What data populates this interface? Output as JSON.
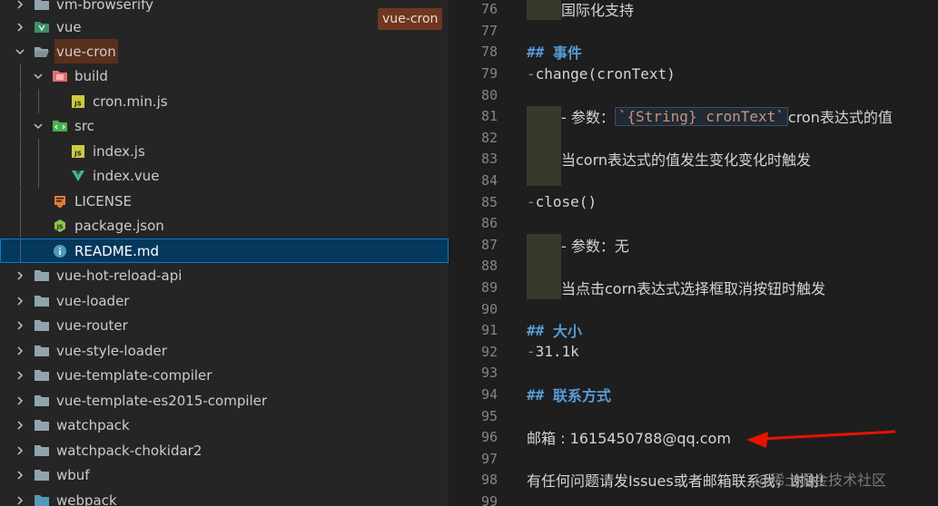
{
  "explorer": {
    "hover_tag": "vue-cron",
    "rows": [
      {
        "label": "vm-browserify",
        "type": "folder",
        "chevron": "right"
      },
      {
        "label": "vue",
        "type": "vue-folder",
        "chevron": "right"
      },
      {
        "label": "vue-cron",
        "type": "folder-open",
        "chevron": "down"
      },
      {
        "label": "build",
        "type": "build-folder",
        "chevron": "down"
      },
      {
        "label": "cron.min.js",
        "type": "js-file"
      },
      {
        "label": "src",
        "type": "src-folder",
        "chevron": "down"
      },
      {
        "label": "index.js",
        "type": "js-file"
      },
      {
        "label": "index.vue",
        "type": "vue-file"
      },
      {
        "label": "LICENSE",
        "type": "license-file"
      },
      {
        "label": "package.json",
        "type": "json-file"
      },
      {
        "label": "README.md",
        "type": "info-file"
      },
      {
        "label": "vue-hot-reload-api",
        "type": "folder",
        "chevron": "right"
      },
      {
        "label": "vue-loader",
        "type": "folder",
        "chevron": "right"
      },
      {
        "label": "vue-router",
        "type": "folder",
        "chevron": "right"
      },
      {
        "label": "vue-style-loader",
        "type": "folder",
        "chevron": "right"
      },
      {
        "label": "vue-template-compiler",
        "type": "folder",
        "chevron": "right"
      },
      {
        "label": "vue-template-es2015-compiler",
        "type": "folder",
        "chevron": "right"
      },
      {
        "label": "watchpack",
        "type": "folder",
        "chevron": "right"
      },
      {
        "label": "watchpack-chokidar2",
        "type": "folder",
        "chevron": "right"
      },
      {
        "label": "wbuf",
        "type": "folder",
        "chevron": "right"
      },
      {
        "label": "webpack",
        "type": "webpack-folder",
        "chevron": "right"
      }
    ]
  },
  "editor": {
    "lines": [
      {
        "num": "76",
        "kind": "quote",
        "text": "国际化支持"
      },
      {
        "num": "77",
        "kind": "blank"
      },
      {
        "num": "78",
        "kind": "heading",
        "hashes": "##",
        "text": "事件"
      },
      {
        "num": "79",
        "kind": "list",
        "text": "change(cronText)"
      },
      {
        "num": "80",
        "kind": "blank"
      },
      {
        "num": "81",
        "kind": "param",
        "prefix": "- 参数：",
        "code": "`{String} cronText`",
        "suffix": " cron表达式的值"
      },
      {
        "num": "82",
        "kind": "blank"
      },
      {
        "num": "83",
        "kind": "quote",
        "text": "当corn表达式的值发生变化变化时触发"
      },
      {
        "num": "84",
        "kind": "blank"
      },
      {
        "num": "85",
        "kind": "list",
        "text": "close()"
      },
      {
        "num": "86",
        "kind": "blank"
      },
      {
        "num": "87",
        "kind": "param-plain",
        "prefix": "- 参数：无"
      },
      {
        "num": "88",
        "kind": "blank"
      },
      {
        "num": "89",
        "kind": "quote",
        "text": "当点击corn表达式选择框取消按钮时触发"
      },
      {
        "num": "90",
        "kind": "blank"
      },
      {
        "num": "91",
        "kind": "heading",
        "hashes": "##",
        "text": "大小"
      },
      {
        "num": "92",
        "kind": "list",
        "text": "31.1k"
      },
      {
        "num": "93",
        "kind": "blank"
      },
      {
        "num": "94",
        "kind": "heading",
        "hashes": "##",
        "text": "联系方式"
      },
      {
        "num": "95",
        "kind": "blank"
      },
      {
        "num": "96",
        "kind": "plain",
        "text": "邮箱 : 1615450788@qq.com"
      },
      {
        "num": "97",
        "kind": "blank"
      },
      {
        "num": "98",
        "kind": "plain",
        "text": "有任何问题请发Issues或者邮箱联系我，谢谢!"
      },
      {
        "num": "99",
        "kind": "blank"
      }
    ]
  },
  "watermark": "@稀土掘金技术社区",
  "colors": {
    "folder": "#c09553",
    "js": "#cbcb41",
    "vue": "#41b883",
    "license": "#e37933",
    "json": "#8bc34a",
    "info": "#519aba",
    "arrow": "#e51400"
  }
}
